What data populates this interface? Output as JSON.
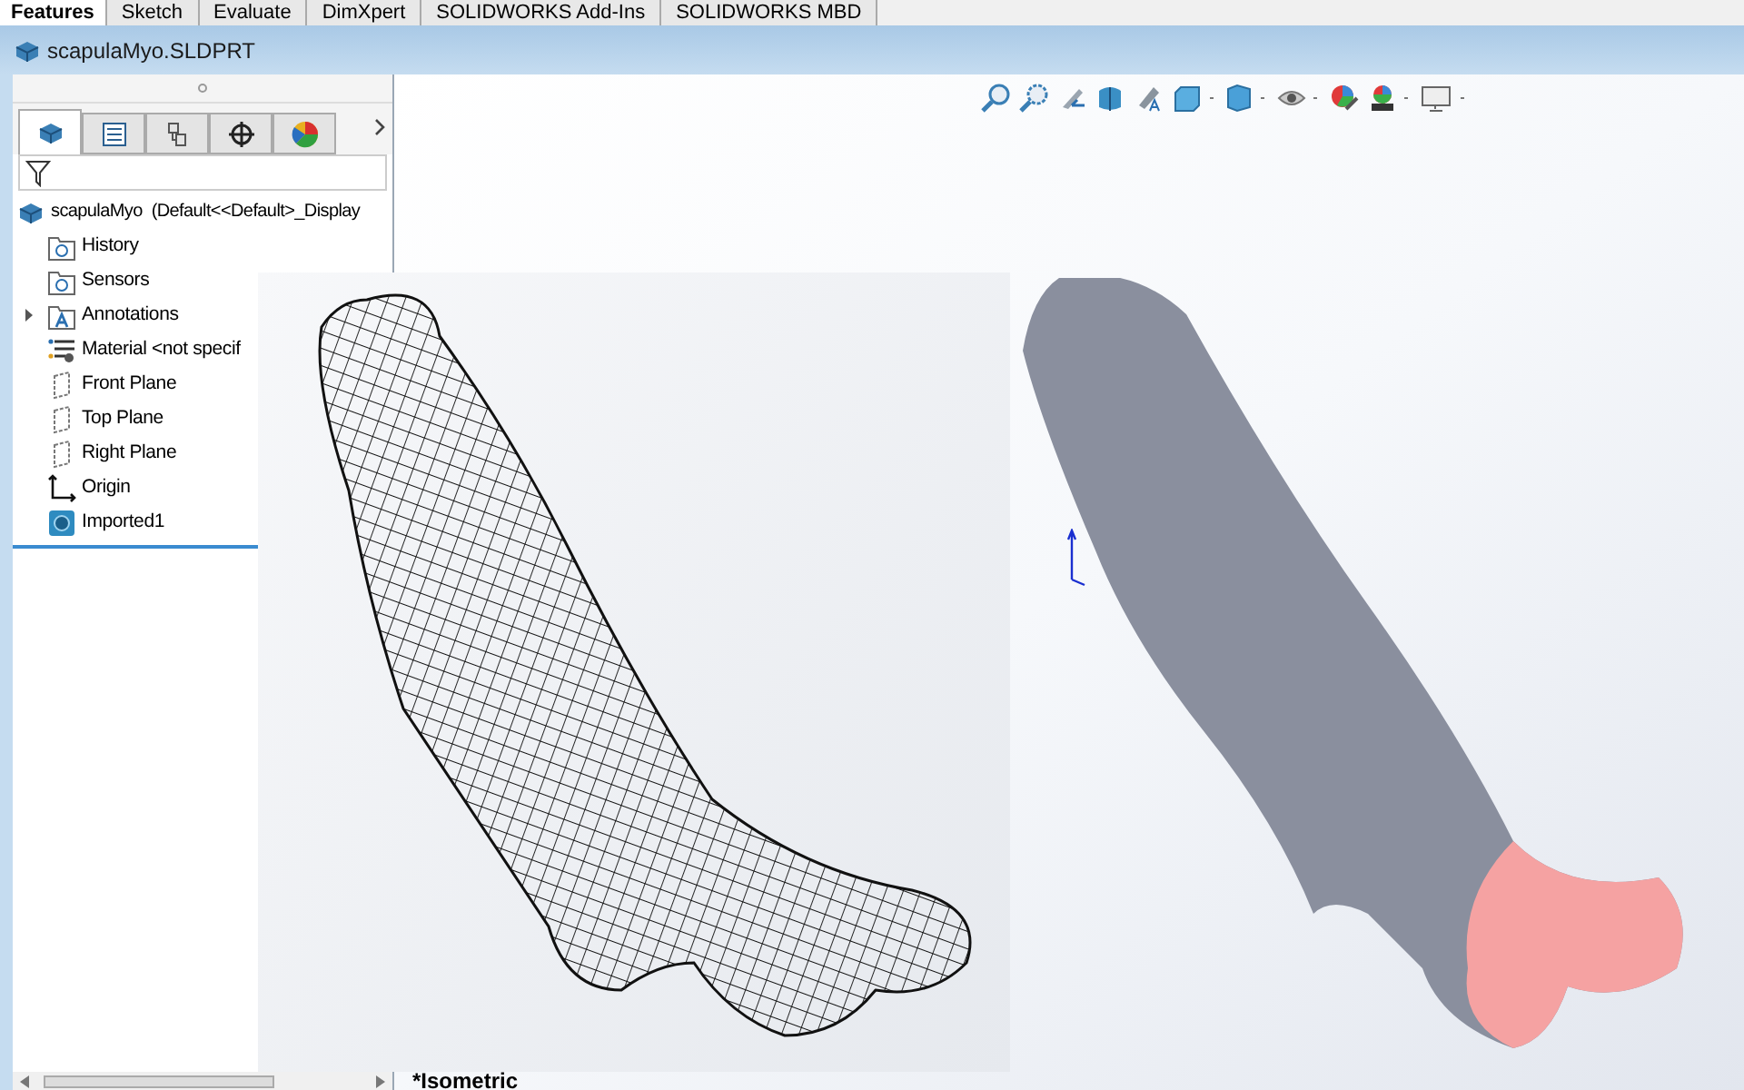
{
  "tabs": [
    {
      "label": "Features",
      "selected": true
    },
    {
      "label": "Sketch",
      "selected": false
    },
    {
      "label": "Evaluate",
      "selected": false
    },
    {
      "label": "DimXpert",
      "selected": false
    },
    {
      "label": "SOLIDWORKS Add-Ins",
      "selected": false
    },
    {
      "label": "SOLIDWORKS MBD",
      "selected": false
    }
  ],
  "document_title": "scapulaMyo.SLDPRT",
  "panel_tabs": [
    {
      "kind": "feature",
      "selected": true
    },
    {
      "kind": "property",
      "selected": false
    },
    {
      "kind": "config",
      "selected": false
    },
    {
      "kind": "dimxpert",
      "selected": false
    },
    {
      "kind": "display",
      "selected": false
    }
  ],
  "tree": {
    "root": "scapulaMyo  (Default<<Default>_Display",
    "items": [
      {
        "label": "History",
        "kind": "folder"
      },
      {
        "label": "Sensors",
        "kind": "folder"
      },
      {
        "label": "Annotations",
        "kind": "annotations",
        "expanded": false
      },
      {
        "label": "Material <not specif",
        "kind": "material"
      },
      {
        "label": "Front Plane",
        "kind": "plane"
      },
      {
        "label": "Top Plane",
        "kind": "plane"
      },
      {
        "label": "Right Plane",
        "kind": "plane"
      },
      {
        "label": "Origin",
        "kind": "origin"
      },
      {
        "label": "Imported1",
        "kind": "body"
      }
    ]
  },
  "view_label": "*Isometric"
}
